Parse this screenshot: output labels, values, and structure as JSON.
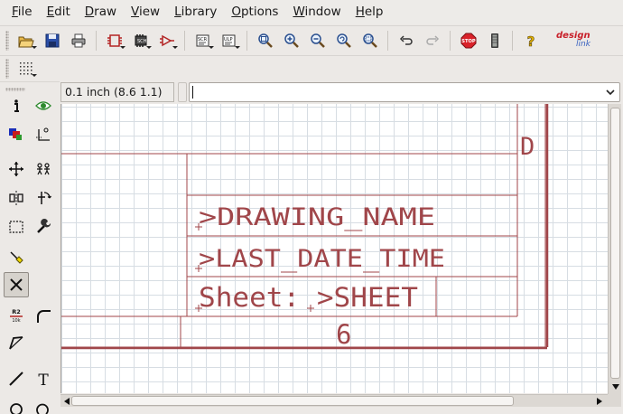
{
  "menu": {
    "items": [
      {
        "label": "File",
        "ul": "F",
        "rest": "ile"
      },
      {
        "label": "Edit",
        "ul": "E",
        "rest": "dit"
      },
      {
        "label": "Draw",
        "ul": "D",
        "rest": "raw"
      },
      {
        "label": "View",
        "ul": "V",
        "rest": "iew"
      },
      {
        "label": "Library",
        "ul": "L",
        "rest": "ibrary"
      },
      {
        "label": "Options",
        "ul": "O",
        "rest": "ptions"
      },
      {
        "label": "Window",
        "ul": "W",
        "rest": "indow"
      },
      {
        "label": "Help",
        "ul": "H",
        "rest": "elp"
      }
    ]
  },
  "toolbar": {
    "icons": [
      "open-icon",
      "save-icon",
      "print-icon",
      "cam-icon",
      "board-icon",
      "schematic-icon",
      "script-icon",
      "ulp-icon",
      "zoom-fit-icon",
      "zoom-in-icon",
      "zoom-out-icon",
      "zoom-redraw-icon",
      "zoom-select-icon",
      "undo-icon",
      "redo-icon",
      "stop-icon",
      "go-icon",
      "help-icon"
    ],
    "stop_label": "STOP",
    "logo_top": "design",
    "logo_bottom": "link"
  },
  "palette": {
    "icons": [
      "info-icon",
      "show-icon",
      "display-layers-icon",
      "mark-icon",
      "move-icon",
      "copy-icon",
      "mirror-icon",
      "rotate-icon",
      "group-icon",
      "change-icon",
      "paste-icon",
      "delete-icon",
      "name-icon",
      "miter-icon",
      "split-icon",
      "wire-icon",
      "text-icon",
      "circle-icon",
      "arc-icon"
    ],
    "name_icon_top": "R2",
    "name_icon_bottom": "10k",
    "text_icon_label": "T"
  },
  "coordinates": {
    "readout": "0.1 inch (8.6 1.1)"
  },
  "command_line": {
    "value": ""
  },
  "frame": {
    "corner_letter": "D",
    "drawing_name": ">DRAWING_NAME",
    "last_date_time": ">LAST_DATE_TIME",
    "sheet": "Sheet: >SHEET",
    "column_number": "6",
    "line_color": "#a0464a"
  },
  "colors": {
    "stop_red": "#d9222a",
    "accent_blue": "#3a62c0"
  }
}
